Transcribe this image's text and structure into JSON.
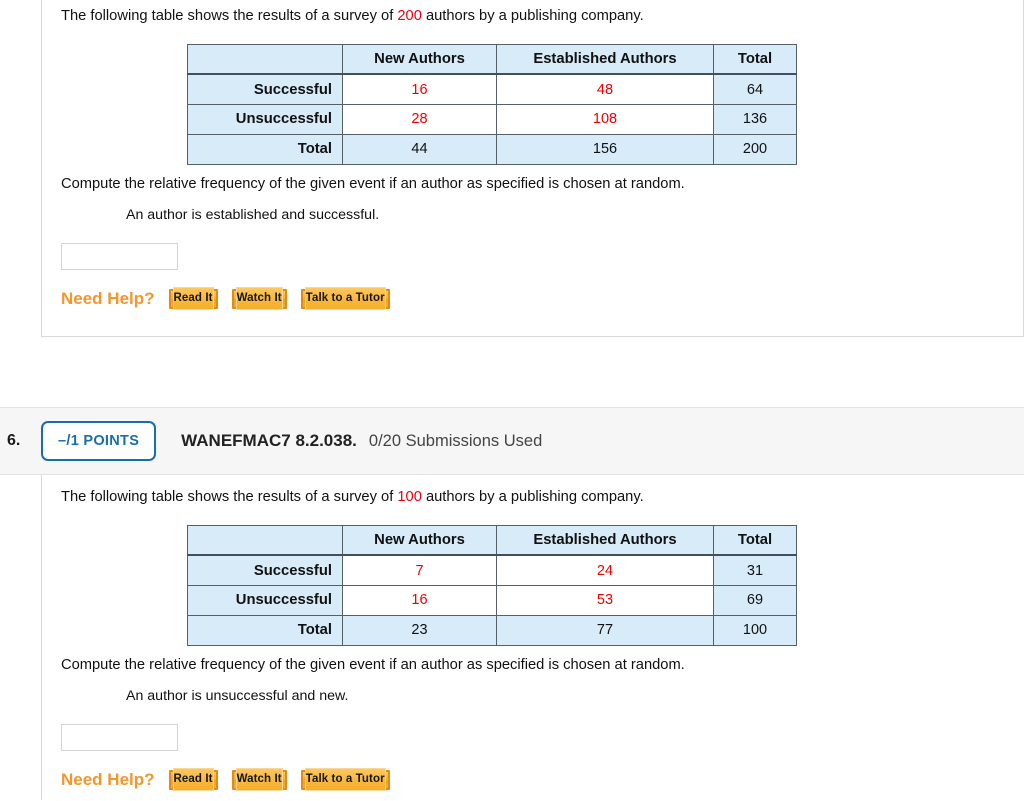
{
  "questions": [
    {
      "id": "q5",
      "has_header": false,
      "statement_pre": "The following table shows the results of a survey of ",
      "statement_count": "200",
      "statement_post": " authors by a publishing company.",
      "table": {
        "corner": "",
        "columns": [
          "New Authors",
          "Established Authors",
          "Total"
        ],
        "rows": [
          {
            "label": "Successful",
            "cells": [
              "16",
              "48",
              "64"
            ],
            "highlight": [
              true,
              true,
              false
            ]
          },
          {
            "label": "Unsuccessful",
            "cells": [
              "28",
              "108",
              "136"
            ],
            "highlight": [
              true,
              true,
              false
            ]
          }
        ],
        "total_row": {
          "label": "Total",
          "cells": [
            "44",
            "156",
            "200"
          ]
        }
      },
      "compute_line": "Compute the relative frequency of the given event if an author as specified is chosen at random.",
      "event_line": "An author is established and successful.",
      "answer_value": "",
      "answer_placeholder": "",
      "need_help_label": "Need Help?",
      "help_buttons": [
        "Read It",
        "Watch It",
        "Talk to a Tutor"
      ]
    },
    {
      "id": "q6",
      "has_header": true,
      "number": "6.",
      "points": "–/1 POINTS",
      "title": "WANEFMAC7 8.2.038.",
      "submissions": "0/20 Submissions Used",
      "statement_pre": "The following table shows the results of a survey of ",
      "statement_count": "100",
      "statement_post": " authors by a publishing company.",
      "table": {
        "corner": "",
        "columns": [
          "New Authors",
          "Established Authors",
          "Total"
        ],
        "rows": [
          {
            "label": "Successful",
            "cells": [
              "7",
              "24",
              "31"
            ],
            "highlight": [
              true,
              true,
              false
            ]
          },
          {
            "label": "Unsuccessful",
            "cells": [
              "16",
              "53",
              "69"
            ],
            "highlight": [
              true,
              true,
              false
            ]
          }
        ],
        "total_row": {
          "label": "Total",
          "cells": [
            "23",
            "77",
            "100"
          ]
        }
      },
      "compute_line": "Compute the relative frequency of the given event if an author as specified is chosen at random.",
      "event_line": "An author is unsuccessful and new.",
      "answer_value": "",
      "answer_placeholder": "",
      "need_help_label": "Need Help?",
      "help_buttons": [
        "Read It",
        "Watch It",
        "Talk to a Tutor"
      ]
    }
  ],
  "colors": {
    "accent_blue": "#1a6ea8",
    "highlight_red": "#ee0000",
    "table_fill": "#d7ebf9",
    "help_orange": "#f2962d",
    "header_band": "#f6f6f6"
  }
}
